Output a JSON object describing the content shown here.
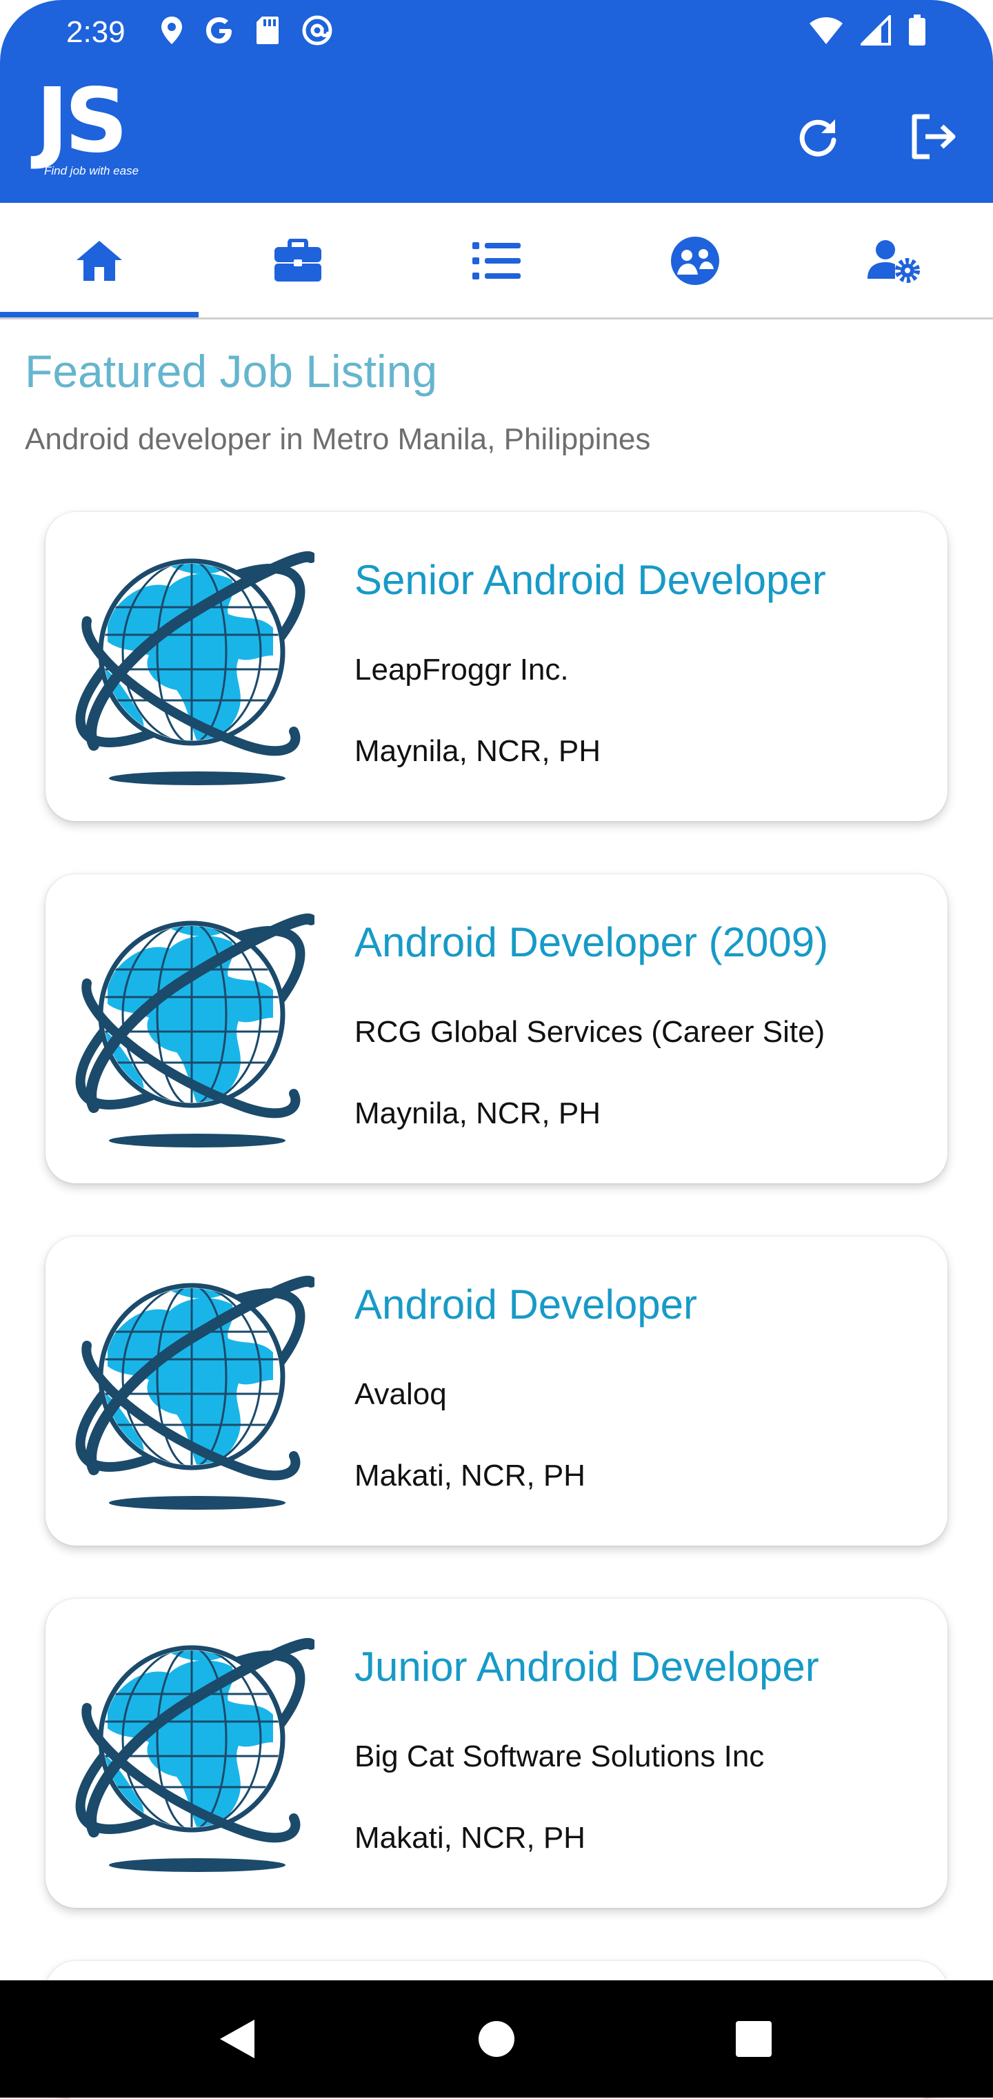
{
  "status_bar": {
    "time": "2:39",
    "left_icons": [
      "location-icon",
      "google-icon",
      "sd-card-icon",
      "at-sign-icon"
    ],
    "right_icons": [
      "wifi-icon",
      "signal-icon",
      "battery-icon"
    ]
  },
  "header": {
    "logo_text": "JS",
    "logo_tagline": "Find job with ease",
    "actions": [
      "refresh-icon",
      "logout-icon"
    ]
  },
  "tabs": [
    {
      "icon": "home-icon",
      "selected": true
    },
    {
      "icon": "briefcase-icon",
      "selected": false
    },
    {
      "icon": "list-icon",
      "selected": false
    },
    {
      "icon": "community-icon",
      "selected": false
    },
    {
      "icon": "user-settings-icon",
      "selected": false
    }
  ],
  "main": {
    "title": "Featured Job Listing",
    "subtitle": "Android developer in Metro Manila, Philippines",
    "jobs": [
      {
        "title": "Senior Android Developer",
        "company": "LeapFroggr Inc.",
        "location": "Maynila, NCR, PH"
      },
      {
        "title": "Android Developer (2009)",
        "company": "RCG Global Services (Career Site)",
        "location": "Maynila, NCR, PH"
      },
      {
        "title": "Android Developer",
        "company": "Avaloq",
        "location": "Makati, NCR, PH"
      },
      {
        "title": "Junior Android Developer",
        "company": "Big Cat Software Solutions Inc",
        "location": "Makati, NCR, PH"
      }
    ]
  },
  "colors": {
    "primary": "#1e62dc",
    "title": "#65b5ce",
    "job_title": "#179ac7",
    "globe_light": "#1ab5e8",
    "globe_dark": "#1b4a6b"
  },
  "navbar": [
    "back-icon",
    "home-circle-icon",
    "recents-icon"
  ]
}
